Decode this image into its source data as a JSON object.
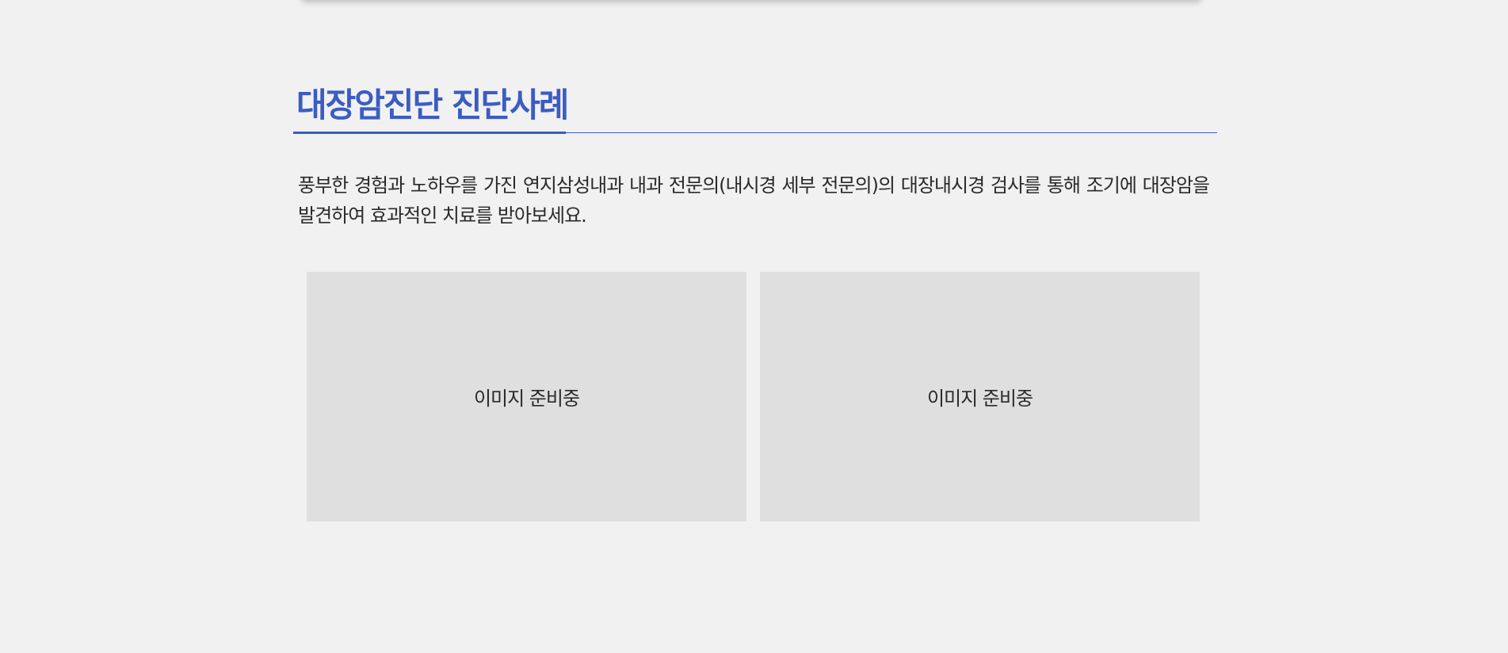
{
  "section": {
    "title": "대장암진단 진단사례",
    "description": "풍부한 경험과 노하우를 가진 연지삼성내과 내과 전문의(내시경 세부 전문의)의 대장내시경 검사를 통해 조기에 대장암을 발견하여 효과적인 치료를 받아보세요."
  },
  "gallery": {
    "images": [
      {
        "placeholder": "이미지 준비중"
      },
      {
        "placeholder": "이미지 준비중"
      }
    ]
  },
  "colors": {
    "accent": "#3b5cc4",
    "background": "#f1f1f1",
    "placeholder_bg": "#dfdfdf",
    "text": "#2a2a2a"
  }
}
